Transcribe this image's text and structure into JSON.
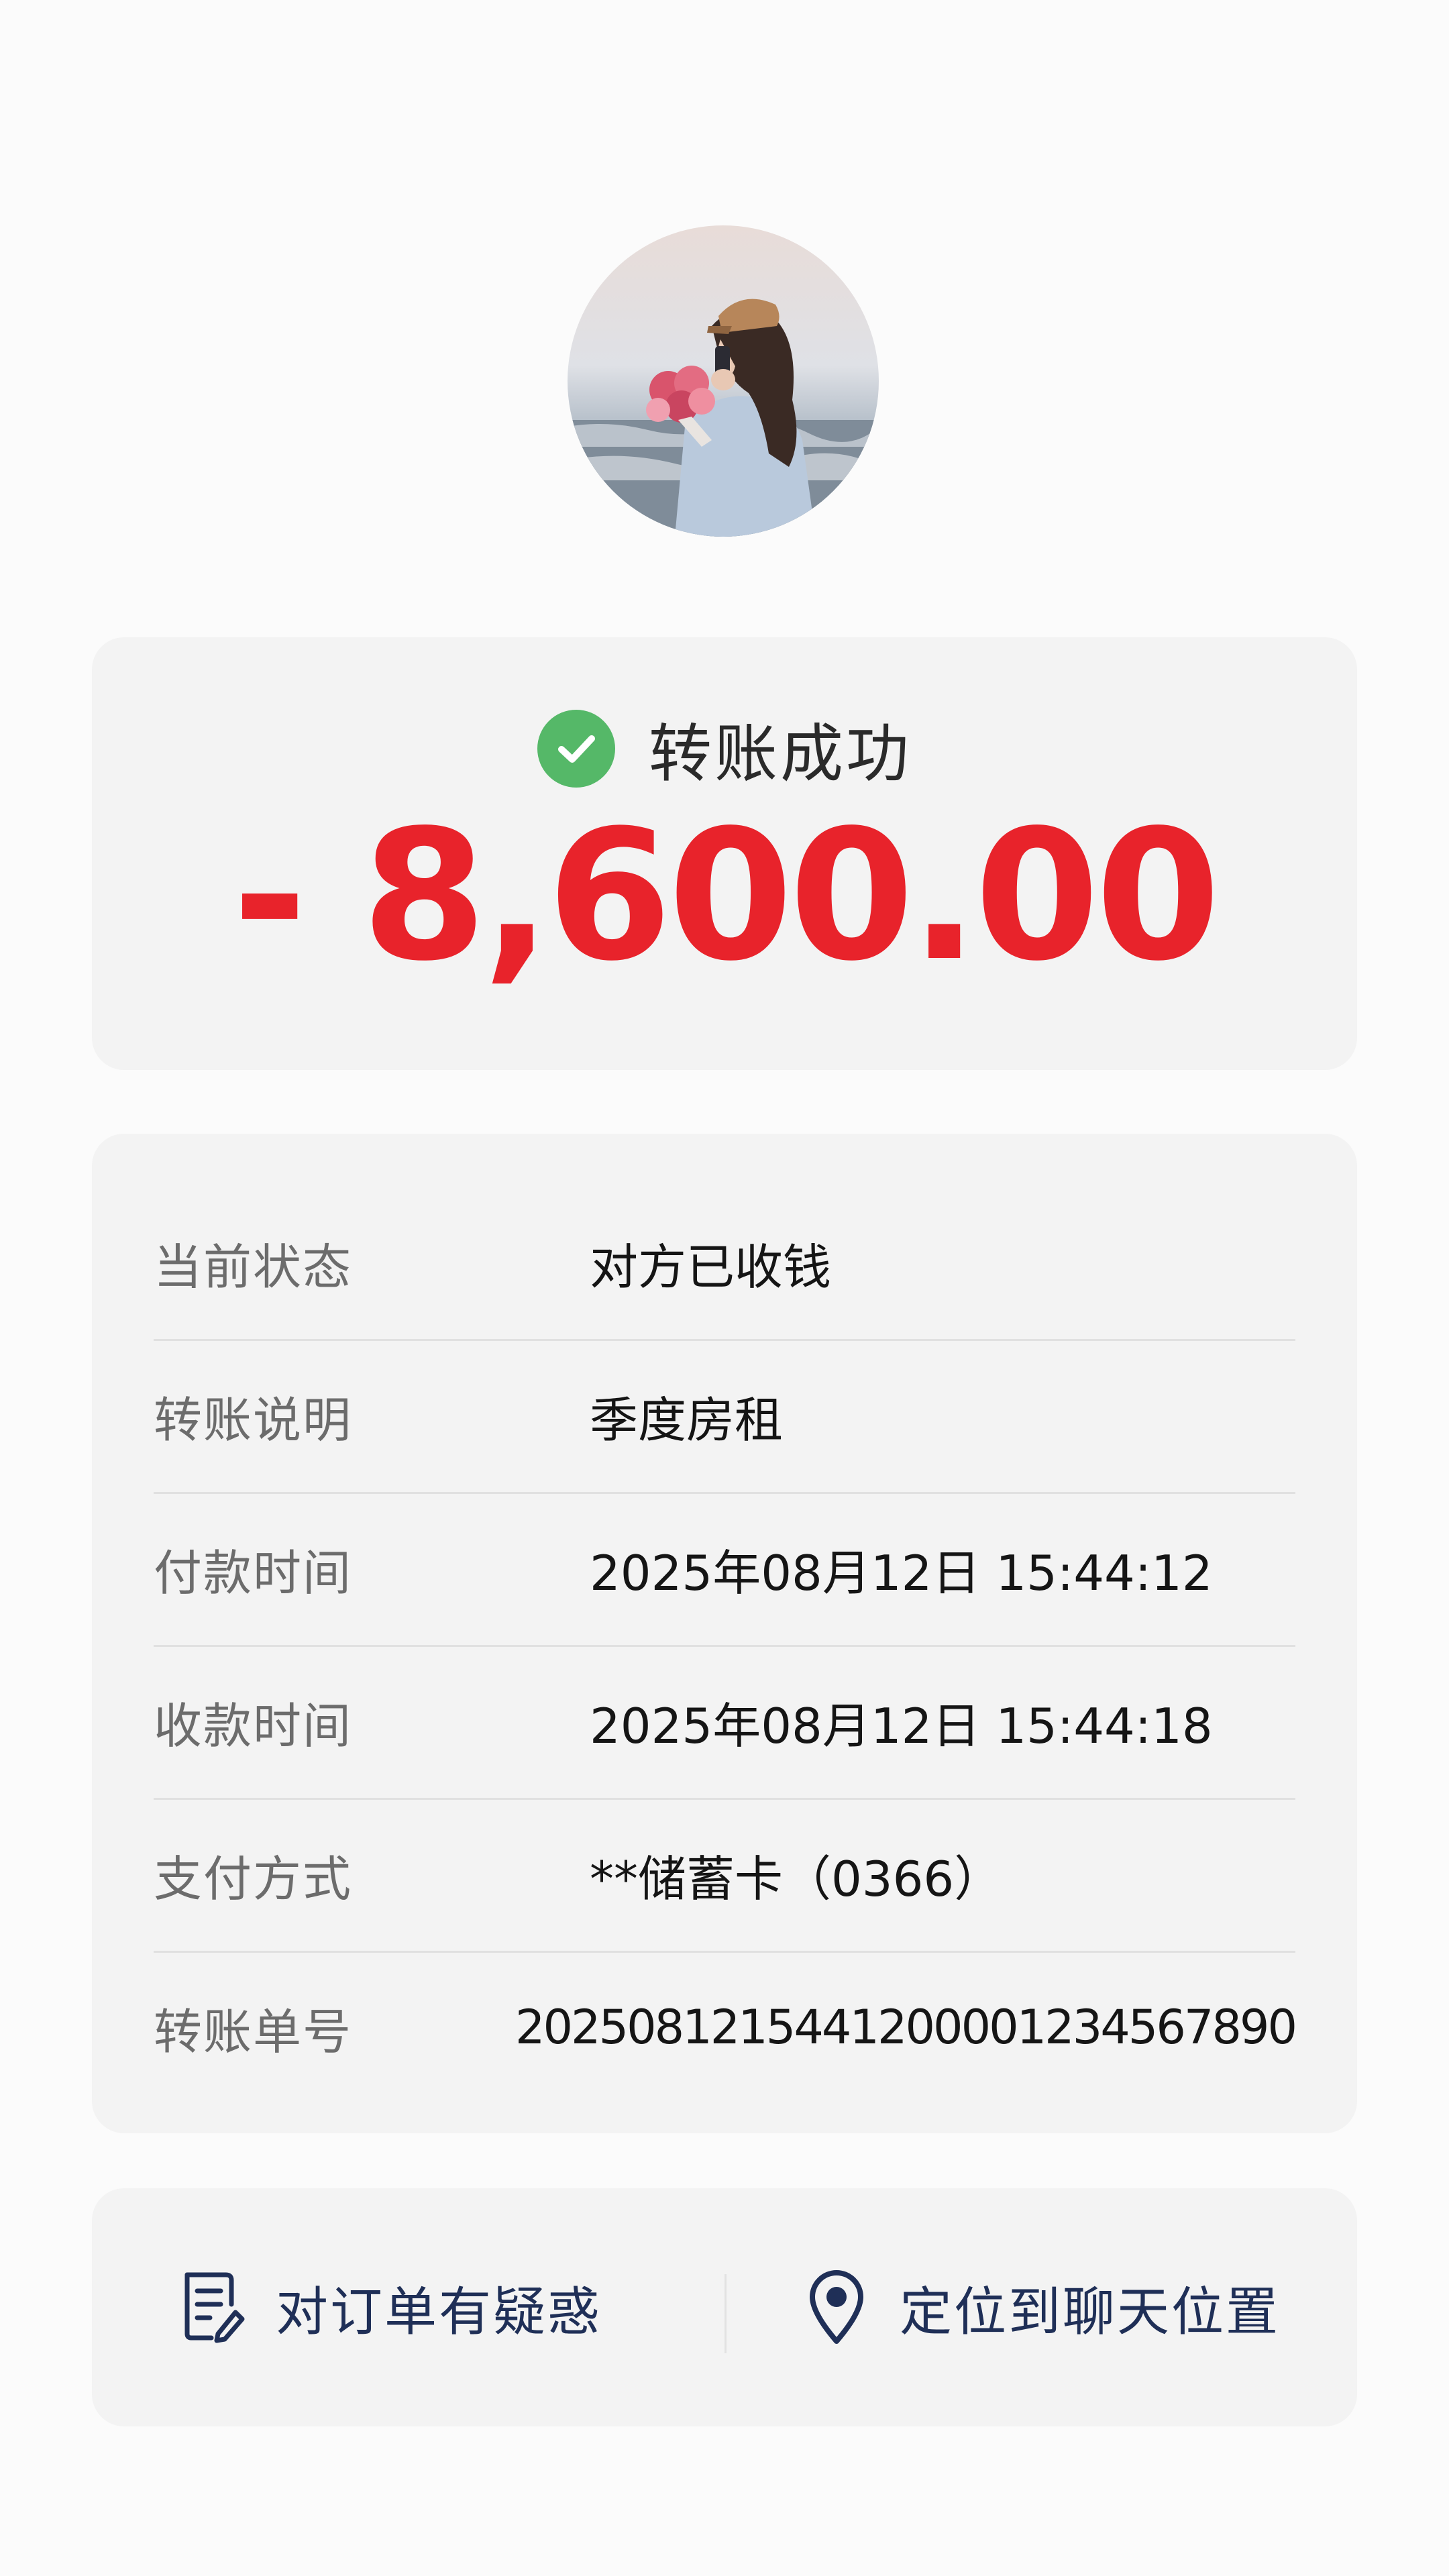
{
  "status": {
    "text": "转账成功",
    "amount": "- 8,600.00",
    "colors": {
      "success": "#55b868",
      "amount": "#e8232b"
    }
  },
  "details": [
    {
      "label": "当前状态",
      "value": "对方已收钱"
    },
    {
      "label": "转账说明",
      "value": "季度房租"
    },
    {
      "label": "付款时间",
      "value": "2025年08月12日  15:44:12"
    },
    {
      "label": "收款时间",
      "value": "2025年08月12日  15:44:18"
    },
    {
      "label": "支付方式",
      "value": "**储蓄卡（0366）"
    },
    {
      "label": "转账单号",
      "value": "2025081215441200001234567890"
    }
  ],
  "actions": {
    "order_question": {
      "label": "对订单有疑惑",
      "icon": "document-pen-icon"
    },
    "locate_chat": {
      "label": "定位到聊天位置",
      "icon": "location-pin-icon"
    },
    "color": "#1f2f57"
  }
}
